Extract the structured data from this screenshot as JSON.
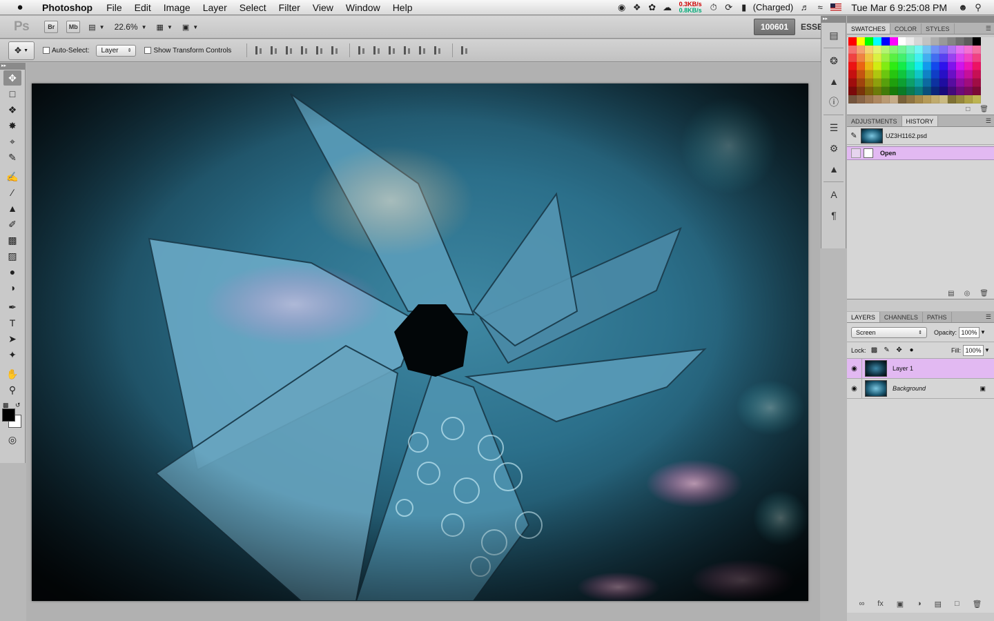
{
  "menubar": {
    "app_name": "Photoshop",
    "items": [
      "File",
      "Edit",
      "Image",
      "Layer",
      "Select",
      "Filter",
      "View",
      "Window",
      "Help"
    ],
    "net_up": "0.3KB/s",
    "net_down": "0.8KB/s",
    "battery_status": "(Charged)",
    "clock": "Tue Mar 6  9:25:08 PM"
  },
  "appbar": {
    "logo": "Ps",
    "bridge": "Br",
    "minibridge": "Mb",
    "zoom": "22.6%",
    "workspace_button": "100601",
    "workspace_label": "ESSE"
  },
  "options": {
    "auto_select_label": "Auto-Select:",
    "auto_select_value": "Layer",
    "show_transform_label": "Show Transform Controls"
  },
  "panels": {
    "swatches_tabs": [
      "SWATCHES",
      "COLOR",
      "STYLES"
    ],
    "history_tabs": [
      "ADJUSTMENTS",
      "HISTORY"
    ],
    "history_snapshot": "UZ3H1162.psd",
    "history_step": "Open",
    "layers_tabs": [
      "LAYERS",
      "CHANNELS",
      "PATHS"
    ],
    "blend_mode": "Screen",
    "opacity_label": "Opacity:",
    "opacity": "100%",
    "lock_label": "Lock:",
    "fill_label": "Fill:",
    "fill": "100%",
    "layers": [
      {
        "name": "Layer 1",
        "selected": true
      },
      {
        "name": "Background",
        "selected": false
      }
    ]
  },
  "colors": {
    "selection": "#e2b9f2",
    "foreground": "#000000",
    "background": "#ffffff"
  }
}
